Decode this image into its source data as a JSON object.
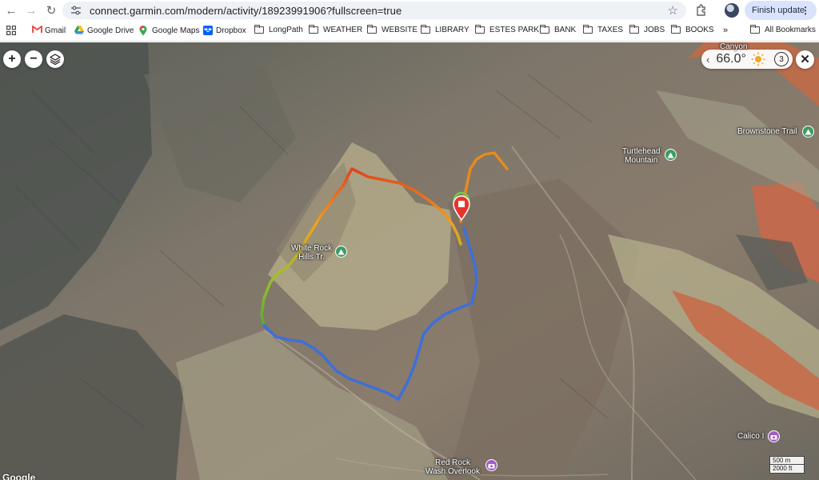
{
  "browser": {
    "url": "connect.garmin.com/modern/activity/18923991906?fullscreen=true",
    "finish_update_label": "Finish update"
  },
  "bookmarks": [
    {
      "label": "Gmail",
      "icon": "gmail-icon"
    },
    {
      "label": "Google Drive",
      "icon": "google-drive-icon"
    },
    {
      "label": "Google Maps",
      "icon": "google-maps-icon"
    },
    {
      "label": "Dropbox",
      "icon": "dropbox-icon"
    },
    {
      "label": "LongPath",
      "icon": "folder-icon"
    },
    {
      "label": "WEATHER",
      "icon": "folder-icon"
    },
    {
      "label": "WEBSITE",
      "icon": "folder-icon"
    },
    {
      "label": "LIBRARY",
      "icon": "folder-icon"
    },
    {
      "label": "ESTES PARK",
      "icon": "folder-icon"
    },
    {
      "label": "BANK",
      "icon": "folder-icon"
    },
    {
      "label": "TAXES",
      "icon": "folder-icon"
    },
    {
      "label": "JOBS",
      "icon": "folder-icon"
    },
    {
      "label": "BOOKS",
      "icon": "folder-icon"
    }
  ],
  "all_bookmarks_label": "All Bookmarks",
  "map": {
    "weather_temp": "66.0°",
    "weather_icon": "sun-icon",
    "weather_count": "3",
    "poi": {
      "white_rock": "White Rock\nHills Tr.",
      "turtlehead": "Turtlehead\nMountain",
      "brownstone": "Brownstone Trail",
      "canyon": "Canyon",
      "calico": "Calico I",
      "red_rock": "Red Rock\nWash Overlook"
    },
    "scale": {
      "metric": "500 m",
      "imperial": "2000 ft"
    },
    "attribution": "Google"
  },
  "colors": {
    "route_low": "#3f6fd8",
    "route_high": "#e0431c",
    "marker": "#e8342b",
    "accent_update_pill": "#d9e3fb"
  }
}
